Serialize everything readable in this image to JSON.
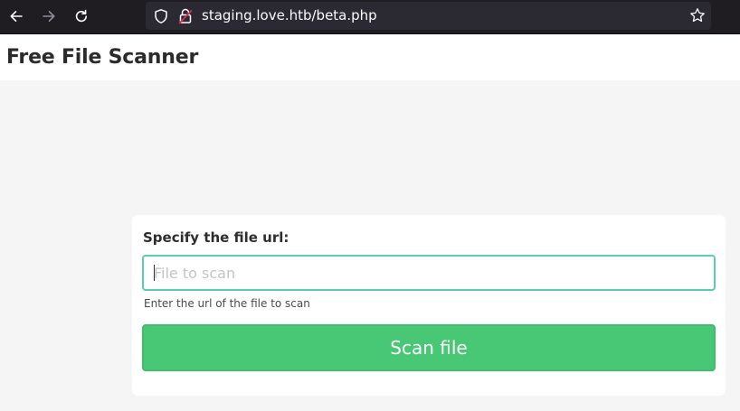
{
  "browser": {
    "url": "staging.love.htb/beta.php",
    "icons": {
      "back": "back-arrow-icon",
      "forward": "forward-arrow-icon",
      "reload": "reload-icon",
      "shield": "shield-icon",
      "lock": "insecure-lock-icon",
      "bookmark": "star-icon"
    }
  },
  "page": {
    "title": "Free File Scanner"
  },
  "form": {
    "label": "Specify the file url:",
    "input_value": "",
    "input_placeholder": "File to scan",
    "help_text": "Enter the url of the file to scan",
    "submit_label": "Scan file"
  },
  "colors": {
    "accent": "#48c774",
    "input_border": "#5ccdb0",
    "toolbar_bg": "#1f1d22",
    "page_bg": "#f5f5f5"
  }
}
